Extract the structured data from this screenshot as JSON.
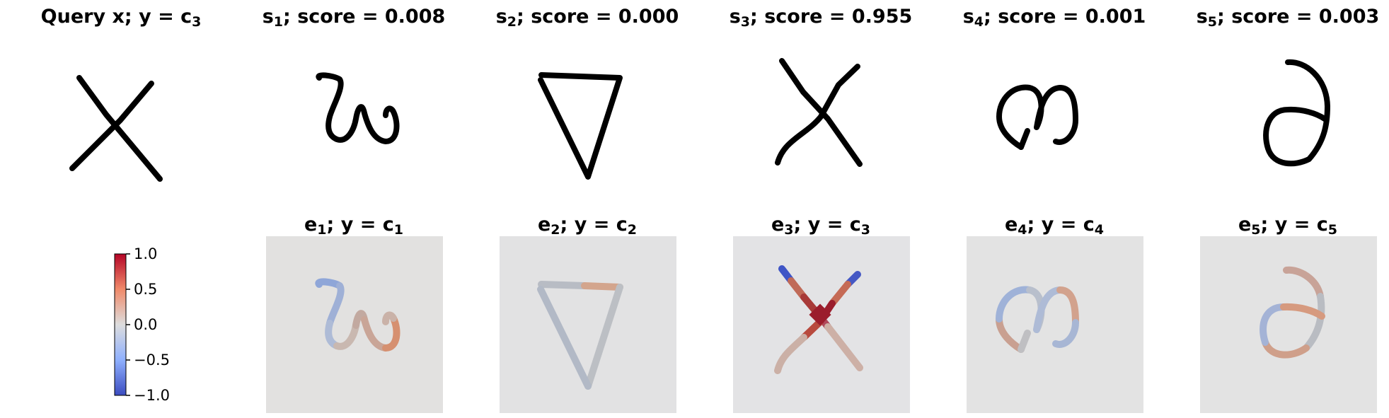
{
  "query": {
    "title_main": "Query x; y = c",
    "title_sub": "3"
  },
  "support": [
    {
      "s_main": "s",
      "s_sub": "1",
      "score_text": "; score = 0.008",
      "e_main": "e",
      "e_sub": "1",
      "e_rest": "; y = c",
      "e_class": "1"
    },
    {
      "s_main": "s",
      "s_sub": "2",
      "score_text": "; score = 0.000",
      "e_main": "e",
      "e_sub": "2",
      "e_rest": "; y = c",
      "e_class": "2"
    },
    {
      "s_main": "s",
      "s_sub": "3",
      "score_text": "; score = 0.955",
      "e_main": "e",
      "e_sub": "3",
      "e_rest": "; y = c",
      "e_class": "3"
    },
    {
      "s_main": "s",
      "s_sub": "4",
      "score_text": "; score = 0.001",
      "e_main": "e",
      "e_sub": "4",
      "e_rest": "; y = c",
      "e_class": "4"
    },
    {
      "s_main": "s",
      "s_sub": "5",
      "score_text": "; score = 0.003",
      "e_main": "e",
      "e_sub": "5",
      "e_rest": "; y = c",
      "e_class": "5"
    }
  ],
  "chart_data": {
    "type": "heatmap",
    "scores": [
      0.008,
      0.0,
      0.955,
      0.001,
      0.003
    ],
    "colorbar": {
      "colormap": "coolwarm",
      "min": -1.0,
      "max": 1.0,
      "ticks": [
        "1.0",
        "0.5",
        "0.0",
        "−0.5",
        "−1.0"
      ],
      "colors": {
        "neg": "#3b4cc0",
        "mid": "#dddddd",
        "pos": "#b40426"
      }
    }
  },
  "colors": {
    "ink": "#000000",
    "panel_bg": "#e3e3e3"
  }
}
